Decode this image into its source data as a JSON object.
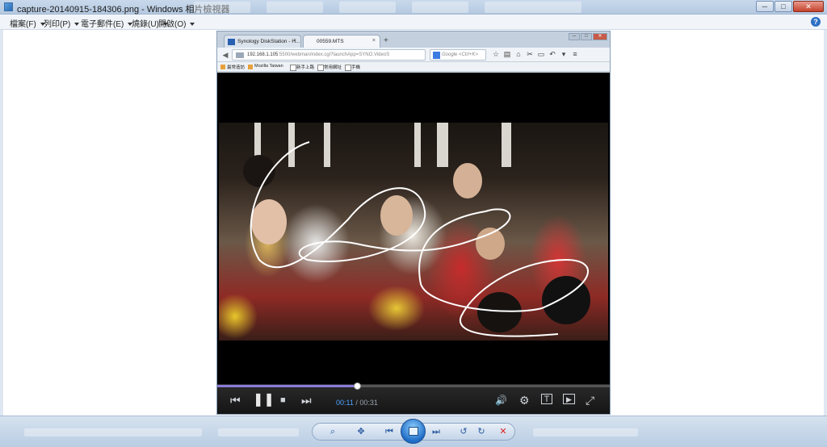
{
  "window": {
    "title": "capture-20140915-184306.png - Windows 相片檢視器",
    "caption_buttons": {
      "minimize": "─",
      "maximize": "□",
      "close": "✕"
    }
  },
  "menu": {
    "items": [
      {
        "label": "檔案(F)"
      },
      {
        "label": "列印(P)"
      },
      {
        "label": "電子郵件(E)"
      },
      {
        "label": "燒錄(U)"
      },
      {
        "label": "開啟(O)"
      }
    ],
    "help_label": "?"
  },
  "browser": {
    "tabs": [
      {
        "label": "Synology DiskStation - H..."
      },
      {
        "label": "00559.MTS"
      }
    ],
    "new_tab": "+",
    "url": "192.168.1.105",
    "url_rest": ":5500/webman/index.cgi?launchApp=SYNO.VideoS",
    "search_placeholder": "Google <Ctrl+K>",
    "bookmarks": [
      "最常造訪",
      "Mozilla Taiwan",
      "新手上路",
      "常用網址",
      "手機"
    ]
  },
  "player": {
    "current_time": "00:11",
    "separator": " / ",
    "duration": "00:31",
    "progress_fraction": 0.355
  },
  "icons": {
    "back": "◀",
    "lock": "lock-icon",
    "star": "☆",
    "home": "⌂",
    "prev": "⏮",
    "pause": "❚❚",
    "stop": "■",
    "next": "⏭",
    "volume": "🔊",
    "settings": "⚙",
    "subtitle": "T",
    "screen": "▶",
    "fullscreen": "⤢"
  },
  "toolbar": {
    "zoom": "⌕",
    "fit": "✥",
    "prev": "⏮",
    "next": "⏭",
    "rotate_ccw": "↺",
    "rotate_cw": "↻",
    "delete": "✕"
  }
}
